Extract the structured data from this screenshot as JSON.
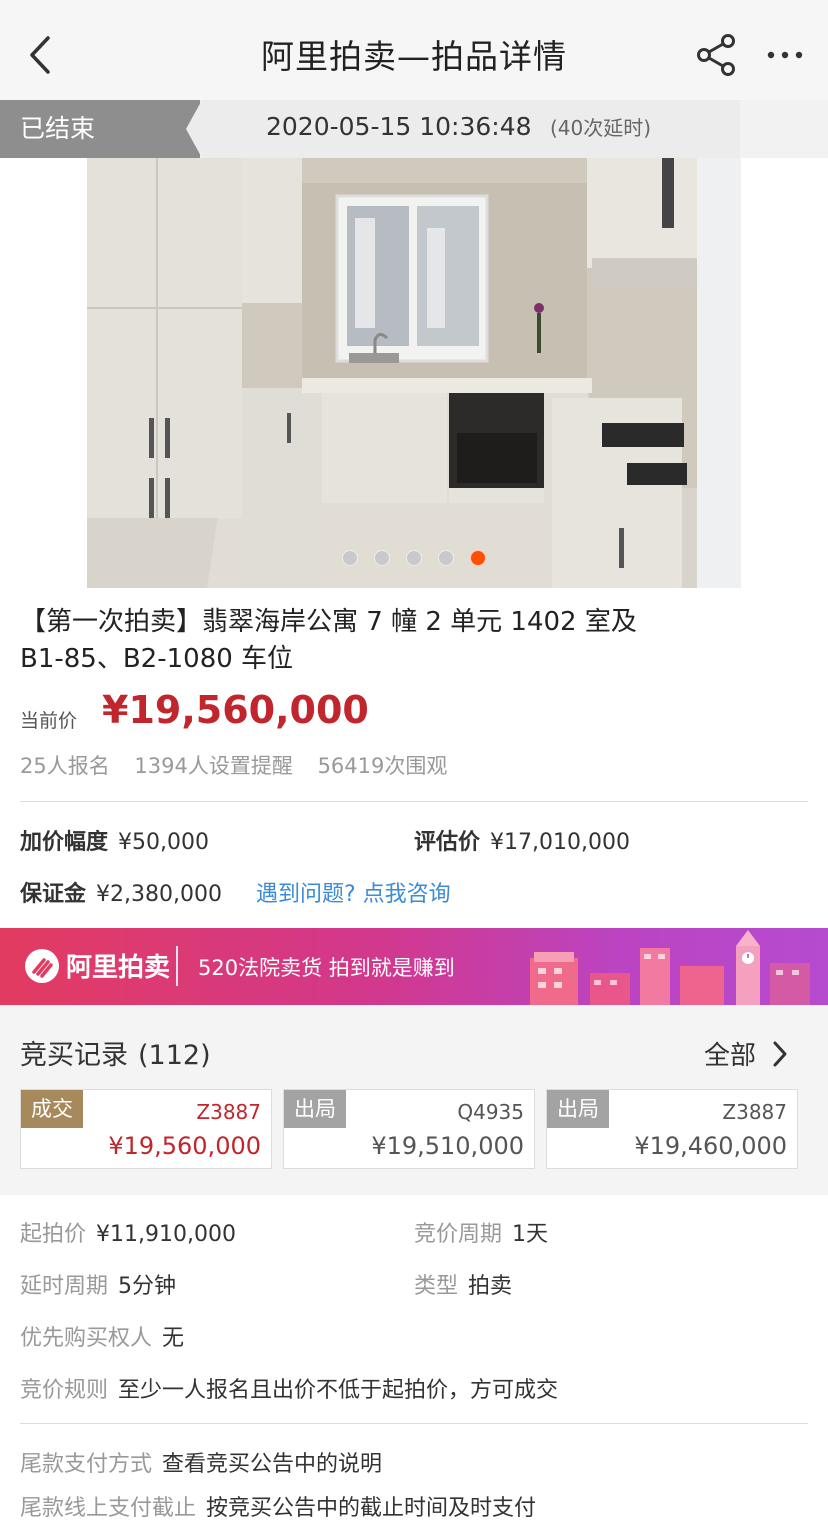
{
  "nav": {
    "title": "阿里拍卖—拍品详情"
  },
  "status": {
    "state": "已结束",
    "end_time": "2020-05-15 10:36:48",
    "extension": "(40次延时)"
  },
  "gallery": {
    "image_count": 5,
    "active_index": 4
  },
  "lot": {
    "title": "【第一次拍卖】翡翠海岸公寓 7 幢 2 单元 1402 室及 B1-85、B2-1080 车位"
  },
  "price": {
    "label": "当前价",
    "value": "¥19,560,000"
  },
  "stats": {
    "signups": "25人报名",
    "reminders": "1394人设置提醒",
    "views": "56419次围观"
  },
  "details": {
    "increment_label": "加价幅度",
    "increment_value": "¥50,000",
    "appraisal_label": "评估价",
    "appraisal_value": "¥17,010,000",
    "deposit_label": "保证金",
    "deposit_value": "¥2,380,000",
    "help_link": "遇到问题? 点我咨询"
  },
  "banner": {
    "brand": "阿里拍卖",
    "slogan": "520法院卖货 拍到就是赚到"
  },
  "records": {
    "title": "竞买记录",
    "count": "(112)",
    "all_label": "全部",
    "items": [
      {
        "tag": "成交",
        "bidder": "Z3887",
        "amount": "¥19,560,000"
      },
      {
        "tag": "出局",
        "bidder": "Q4935",
        "amount": "¥19,510,000"
      },
      {
        "tag": "出局",
        "bidder": "Z3887",
        "amount": "¥19,460,000"
      }
    ]
  },
  "info": {
    "start_price_label": "起拍价",
    "start_price_value": "¥11,910,000",
    "bid_period_label": "竞价周期",
    "bid_period_value": "1天",
    "delay_period_label": "延时周期",
    "delay_period_value": "5分钟",
    "type_label": "类型",
    "type_value": "拍卖",
    "priority_label": "优先购买权人",
    "priority_value": "无",
    "rule_label": "竞价规则",
    "rule_value": "至少一人报名且出价不低于起拍价，方可成交",
    "payment_method_label": "尾款支付方式",
    "payment_method_value": "查看竞买公告中的说明",
    "payment_deadline_label": "尾款线上支付截止",
    "payment_deadline_value": "按竞买公告中的截止时间及时支付"
  },
  "colors": {
    "accent_red": "#c0262c",
    "link_blue": "#3b8bd8",
    "active_dot": "#ff5000",
    "deal_tag": "#a68a5b",
    "out_tag": "#a3a3a3"
  }
}
